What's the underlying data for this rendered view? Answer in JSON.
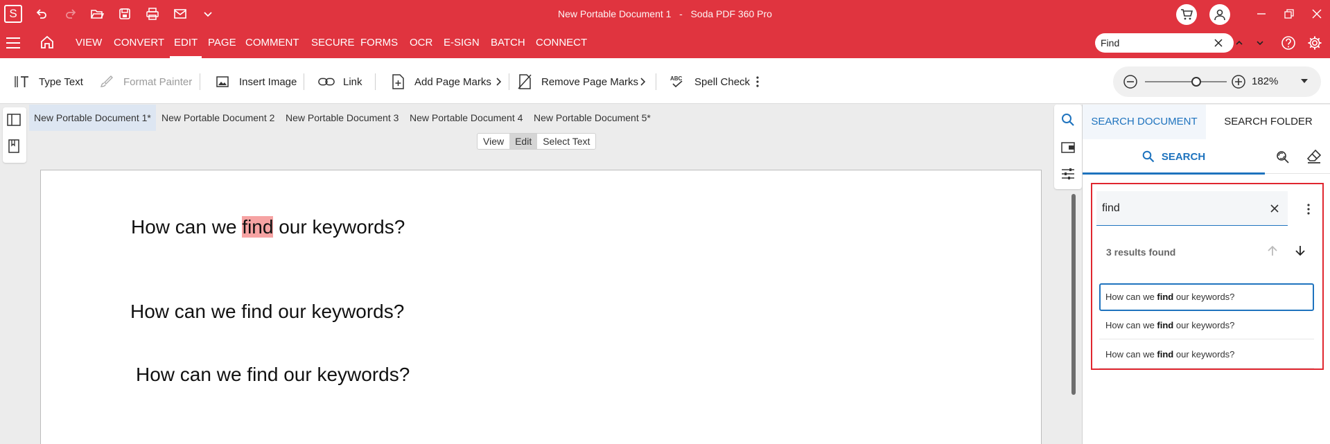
{
  "window": {
    "title_doc": "New Portable Document 1",
    "title_sep": "-",
    "title_app": "Soda PDF 360 Pro",
    "logo": "S",
    "accent": "#e0343f"
  },
  "quick_access": [
    "undo-icon",
    "redo-icon",
    "open-folder-icon",
    "save-icon",
    "print-icon",
    "email-icon",
    "chevron-down-icon"
  ],
  "ribbon": {
    "tabs": [
      "VIEW",
      "CONVERT",
      "EDIT",
      "PAGE",
      "COMMENT",
      "SECURE",
      "FORMS",
      "OCR",
      "E-SIGN",
      "BATCH",
      "CONNECT"
    ],
    "active": "EDIT",
    "find_value": "Find"
  },
  "toolbar": {
    "type_text": "Type Text",
    "format_painter": "Format Painter",
    "insert_image": "Insert Image",
    "link": "Link",
    "add_page_marks": "Add Page Marks",
    "remove_page_marks": "Remove Page Marks",
    "spell_check": "Spell Check",
    "spell_icon_label": "ABC",
    "zoom": "182%"
  },
  "doc_tabs": [
    "New Portable Document 1*",
    "New Portable Document 2",
    "New Portable Document 3",
    "New Portable Document 4",
    "New Portable Document 5*"
  ],
  "modes": [
    "View",
    "Edit",
    "Select Text"
  ],
  "active_mode": "Edit",
  "page": {
    "line1_pre": "How can we ",
    "line1_hit": "find",
    "line1_post": " our keywords?",
    "line2": "How can we find our keywords?",
    "line3": "How can we find our keywords?"
  },
  "panel": {
    "tab_document": "SEARCH DOCUMENT",
    "tab_folder": "SEARCH FOLDER",
    "search_label": "SEARCH",
    "query": "find",
    "results_count": "3 results found",
    "results": [
      {
        "pre": "How can we ",
        "hit": "find",
        "post": " our keywords?"
      },
      {
        "pre": "How can we ",
        "hit": "find",
        "post": " our keywords?"
      },
      {
        "pre": "How can we ",
        "hit": "find",
        "post": " our keywords?"
      }
    ]
  }
}
